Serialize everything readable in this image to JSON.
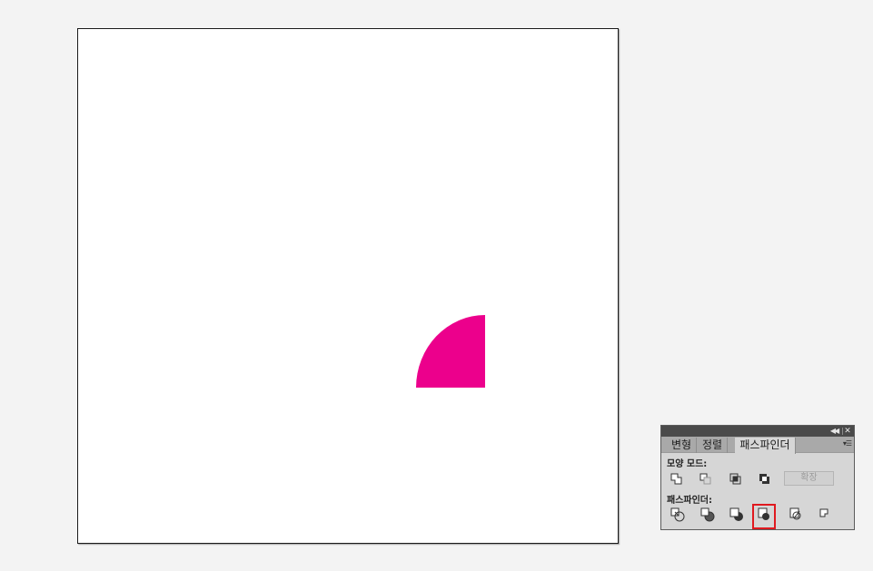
{
  "canvas": {
    "shape_color": "#ec008c"
  },
  "panel": {
    "tabs": [
      {
        "label": "변형"
      },
      {
        "label": "정렬"
      },
      {
        "label": "패스파인더"
      }
    ],
    "shape_modes": {
      "label": "모양 모드:",
      "icons": [
        "unite-icon",
        "minus-front-icon",
        "intersect-icon",
        "exclude-icon"
      ],
      "expand_label": "확장"
    },
    "pathfinders": {
      "label": "패스파인더:",
      "icons": [
        "divide-icon",
        "trim-icon",
        "merge-icon",
        "crop-icon",
        "outline-icon",
        "minus-back-icon"
      ]
    },
    "highlight_color": "#e0191f"
  }
}
